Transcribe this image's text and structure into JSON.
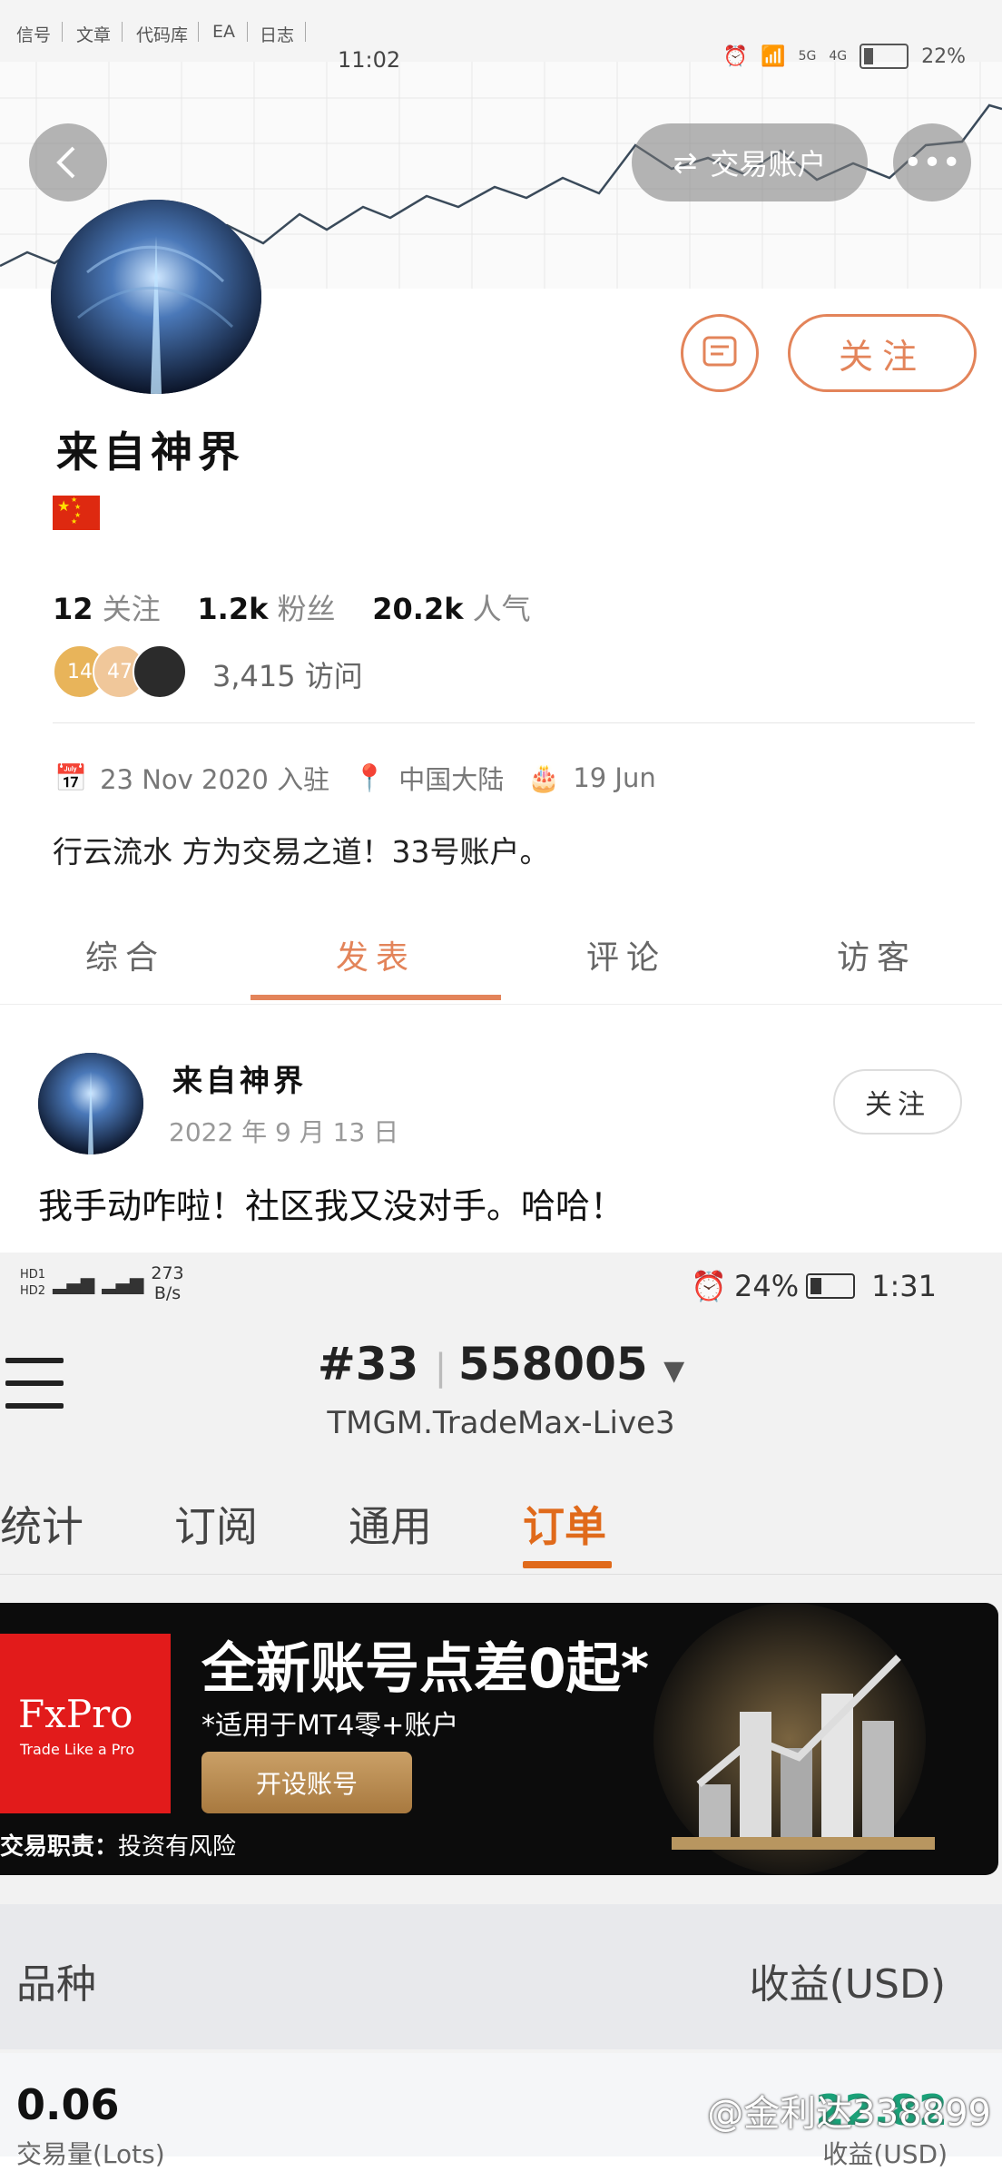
{
  "top_strip": {
    "tabs": [
      "信号",
      "文章",
      "代码库",
      "EA",
      "日志"
    ]
  },
  "status_bar_1": {
    "time": "11:02",
    "battery": "22%",
    "net1": "5G",
    "net2": "4G"
  },
  "header": {
    "switch_account_label": "交易账户"
  },
  "profile": {
    "name": "来自神界",
    "follow_label": "关注",
    "stats": {
      "following": "12",
      "following_label": "关注",
      "fans": "1.2k",
      "fans_label": "粉丝",
      "popularity": "20.2k",
      "popularity_label": "人气"
    },
    "visitor_badges": [
      "14",
      "47"
    ],
    "visits": "3,415",
    "visits_label": "访问",
    "joined": "23 Nov 2020 入驻",
    "location": "中国大陆",
    "birthday": "19 Jun",
    "bio": "行云流水 方为交易之道！33号账户。"
  },
  "profile_tabs": [
    "综合",
    "发表",
    "评论",
    "访客"
  ],
  "active_profile_tab": "发表",
  "post": {
    "user": "来自神界",
    "date": "2022 年 9 月 13 日",
    "follow_label": "关注",
    "text": "我手动咋啦！社区我又没对手。哈哈！"
  },
  "status_bar_2": {
    "speed": "273",
    "speed_unit": "B/s",
    "battery": "24%",
    "time": "1:31"
  },
  "account": {
    "number": "#33",
    "login": "558005",
    "server": "TMGM.TradeMax-Live3"
  },
  "account_tabs": [
    "统计",
    "订阅",
    "通用",
    "订单"
  ],
  "active_account_tab": "订单",
  "banner": {
    "brand": "FxPro",
    "brand_tagline": "Trade Like a Pro",
    "title": "全新账号点差0起*",
    "subtitle": "*适用于MT4零+账户",
    "button": "开设账号",
    "disclaimer_bold": "交易职责：",
    "disclaimer": "投资有风险"
  },
  "orders_table": {
    "col_symbol": "品种",
    "col_profit": "收益(USD)",
    "row_lots": "0.06",
    "row_lots_label": "交易量(Lots)",
    "row_profit": "22.82",
    "row_profit_label": "收益(USD)"
  },
  "watermark": "@金利达338899",
  "colors": {
    "accent_orange": "#e3845a",
    "tab_orange": "#e06a1b",
    "profit_green": "#1aa178",
    "fxpro_red": "#e21b1b"
  }
}
